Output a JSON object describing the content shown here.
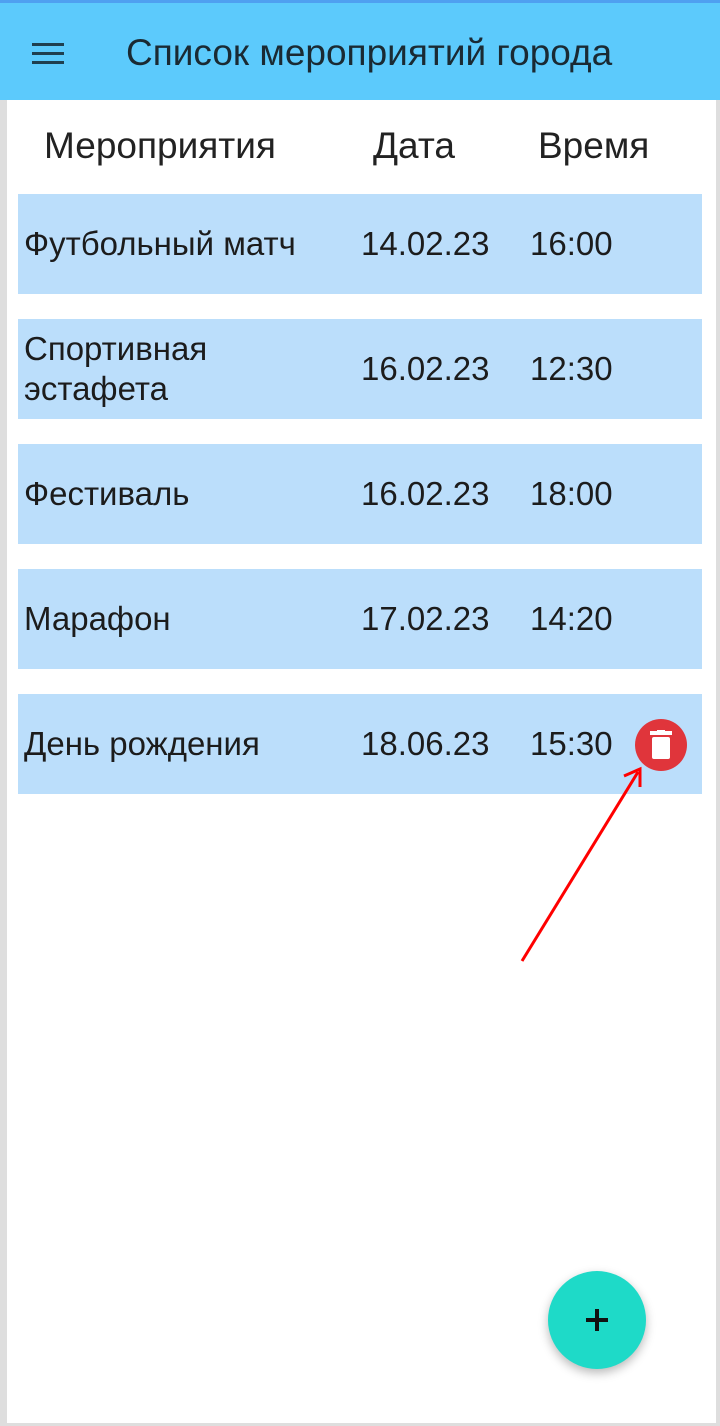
{
  "app_bar": {
    "title": "Список мероприятий города",
    "menu_icon": "hamburger-menu-icon",
    "background": "#5ccafc"
  },
  "table": {
    "headers": {
      "name": "Мероприятия",
      "date": "Дата",
      "time": "Время"
    },
    "row_background": "#bbdefb",
    "rows": [
      {
        "name": "Футбольный матч",
        "date": "14.02.23",
        "time": "16:00"
      },
      {
        "name": "Спортивная эстафета",
        "date": "16.02.23",
        "time": "12:30"
      },
      {
        "name": "Фестиваль",
        "date": "16.02.23",
        "time": "18:00"
      },
      {
        "name": "Марафон",
        "date": "17.02.23",
        "time": "14:20"
      },
      {
        "name": "День рождения",
        "date": "18.06.23",
        "time": "15:30",
        "action_icon": "trash-icon"
      }
    ]
  },
  "delete_button": {
    "color": "#e0353b",
    "icon": "trash-icon"
  },
  "annotation_arrow": {
    "color": "#ff0000",
    "points_to": "delete-button"
  },
  "fab": {
    "icon": "plus-icon",
    "color": "#1edac8"
  }
}
